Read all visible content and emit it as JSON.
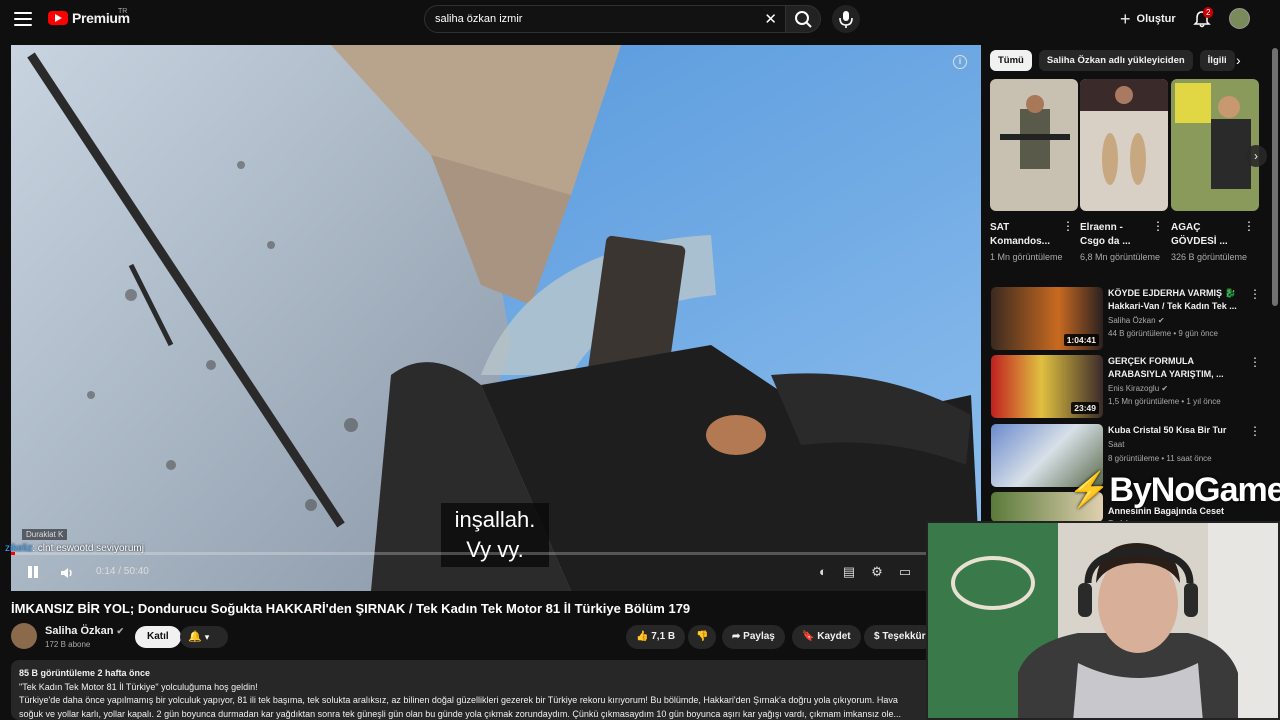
{
  "header": {
    "logo_text": "Premium",
    "logo_region": "TR",
    "search_value": "saliha özkan izmir",
    "create_label": "Oluştur",
    "notification_count": "2"
  },
  "player": {
    "subtitle_line1": "inşallah.",
    "subtitle_line2": "Vy vy.",
    "tooltip": "Duraklat  K",
    "chat_user": "zikeliz",
    "chat_message": ": clnt eswootd seviyorumj",
    "time": "0:14 / 50:40",
    "progress": 0.0046
  },
  "video": {
    "title": "İMKANSIZ BİR YOL; Dondurucu Soğukta HAKKARİ'den ŞIRNAK / Tek Kadın Tek Motor 81 İl Türkiye Bölüm 179",
    "channel": "Saliha Özkan",
    "subscribers": "172 B abone",
    "join_label": "Katıl",
    "likes": "7,1 B",
    "share_label": "Paylaş",
    "save_label": "Kaydet",
    "thanks_label": "Teşekkür",
    "desc_meta": "85 B görüntüleme  2 hafta önce",
    "desc_line1": "\"Tek Kadın Tek Motor 81 İl Türkiye\" yolculuğuma hoş geldin!",
    "desc_line2": "Türkiye'de daha önce yapılmamış bir yolculuk yapıyor, 81 ili tek başıma, tek solukta aralıksız, az bilinen doğal güzellikleri gezerek bir Türkiye rekoru kırıyorum! Bu bölümde, Hakkari'den Şırnak'a doğru yola çıkıyorum. Hava",
    "desc_line3": "soğuk ve yollar karlı, yollar kapalı. 2 gün boyunca durmadan kar yağdıktan sonra tek güneşli gün olan bu günde yola çıkmak zorundaydım. Çünkü çıkmasaydım 10 gün boyunca aşırı kar yağışı vardı, çıkmam imkansız ole..."
  },
  "sidebar": {
    "chips": [
      "Tümü",
      "Saliha Özkan adlı yükleyiciden",
      "İlgili"
    ],
    "shorts": [
      {
        "title": "SAT Komandos...",
        "views": "1 Mn görüntüleme"
      },
      {
        "title": "Elraenn - Csgo da ...",
        "views": "6,8 Mn görüntüleme"
      },
      {
        "title": "AGAÇ GÖVDESİ ...",
        "views": "326 B görüntüleme"
      }
    ],
    "recs": [
      {
        "title": "KÖYDE EJDERHA VARMIŞ 🐉 Hakkari-Van / Tek Kadın Tek ...",
        "channel": "Saliha Özkan",
        "views": "44 B görüntüleme • 9 gün önce",
        "duration": "1:04:41"
      },
      {
        "title": "GERÇEK FORMULA ARABASIYLA YARIŞTIM, ...",
        "channel": "Enis Kirazoglu",
        "views": "1,5 Mn görüntüleme • 1 yıl önce",
        "duration": "23:49"
      },
      {
        "title": "Kuba Cristal 50 Kısa Bir Tur",
        "channel": "Saat",
        "views": "8 görüntüleme • 11 saat önce",
        "duration": ""
      },
      {
        "title": "Annesinin Bagajında Ceset Buldu",
        "channel": "",
        "views": "",
        "duration": ""
      }
    ]
  },
  "overlay": {
    "watermark": "ByNoGame"
  }
}
